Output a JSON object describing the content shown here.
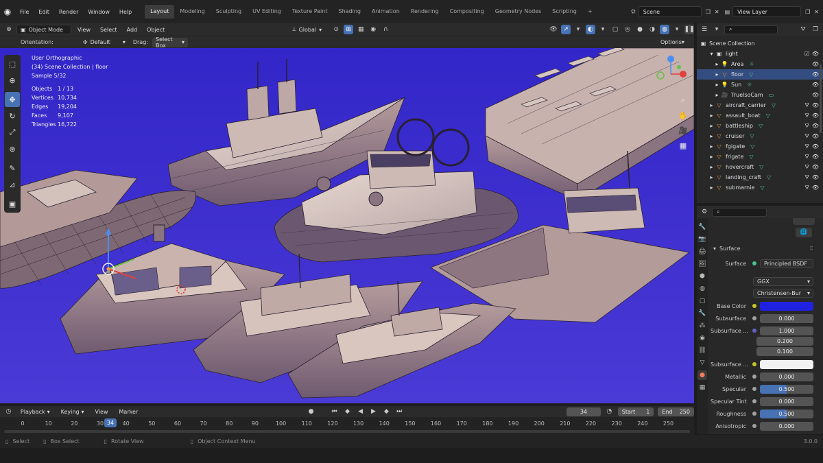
{
  "menubar": {
    "menus": [
      "File",
      "Edit",
      "Render",
      "Window",
      "Help"
    ],
    "workspaces": [
      "Layout",
      "Modeling",
      "Sculpting",
      "UV Editing",
      "Texture Paint",
      "Shading",
      "Animation",
      "Rendering",
      "Compositing",
      "Geometry Nodes",
      "Scripting"
    ],
    "active_workspace": "Layout",
    "add_tab": "+",
    "scene": "Scene",
    "view_layer": "View Layer"
  },
  "viewport_header": {
    "mode": "Object Mode",
    "menus": [
      "View",
      "Select",
      "Add",
      "Object"
    ],
    "transform_orientation": "Global"
  },
  "tool_settings": {
    "orientation_label": "Orientation:",
    "orientation_value": "Default",
    "drag_label": "Drag:",
    "drag_value": "Select Box",
    "options": "Options"
  },
  "viewport_overlay": {
    "view": "User Orthographic",
    "collection": "(34) Scene Collection | floor",
    "sample": "Sample 5/32",
    "stats": [
      {
        "label": "Objects",
        "value": "1 / 13"
      },
      {
        "label": "Vertices",
        "value": "10,734"
      },
      {
        "label": "Edges",
        "value": "19,204"
      },
      {
        "label": "Faces",
        "value": "9,107"
      },
      {
        "label": "Triangles",
        "value": "16,722"
      }
    ]
  },
  "timeline": {
    "menus": [
      "Playback",
      "Keying",
      "View",
      "Marker"
    ],
    "current_frame": "34",
    "start_label": "Start",
    "start": "1",
    "end_label": "End",
    "end": "250",
    "ticks": [
      "0",
      "10",
      "20",
      "30",
      "40",
      "50",
      "60",
      "70",
      "80",
      "90",
      "100",
      "110",
      "120",
      "130",
      "140",
      "150",
      "160",
      "170",
      "180",
      "190",
      "200",
      "210",
      "220",
      "230",
      "240",
      "250"
    ]
  },
  "statusbar": {
    "select": "Select",
    "box_select": "Box Select",
    "rotate_view": "Rotate View",
    "context_menu": "Object Context Menu",
    "version": "3.0.0"
  },
  "outliner": {
    "root": "Scene Collection",
    "rows": [
      {
        "name": "light",
        "indent": 1,
        "kind": "collection"
      },
      {
        "name": "Area",
        "indent": 2,
        "kind": "light"
      },
      {
        "name": "floor",
        "indent": 2,
        "kind": "mesh",
        "selected": true
      },
      {
        "name": "Sun",
        "indent": 2,
        "kind": "light"
      },
      {
        "name": "TrueIsoCam",
        "indent": 2,
        "kind": "camera"
      },
      {
        "name": "aircraft_carrier",
        "indent": 1,
        "kind": "mesh"
      },
      {
        "name": "assault_boat",
        "indent": 1,
        "kind": "mesh"
      },
      {
        "name": "battleship",
        "indent": 1,
        "kind": "mesh"
      },
      {
        "name": "cruiser",
        "indent": 1,
        "kind": "mesh"
      },
      {
        "name": "fgigate",
        "indent": 1,
        "kind": "mesh"
      },
      {
        "name": "frigate",
        "indent": 1,
        "kind": "mesh"
      },
      {
        "name": "hovercraft",
        "indent": 1,
        "kind": "mesh"
      },
      {
        "name": "landing_craft",
        "indent": 1,
        "kind": "mesh"
      },
      {
        "name": "submarnie",
        "indent": 1,
        "kind": "mesh"
      }
    ]
  },
  "properties": {
    "section": "Surface",
    "surface_label": "Surface",
    "surface_value": "Principled BSDF",
    "distribution": "GGX",
    "subsurface_method": "Christensen-Bur",
    "base_color_label": "Base Color",
    "base_color": "#1f22e0",
    "subsurface_label": "Subsurface",
    "subsurface": "0.000",
    "subsurface_radius_label": "Subsurface ...",
    "subsurface_radius": [
      "1.000",
      "0.200",
      "0.100"
    ],
    "subsurface_color_label": "Subsurface ...",
    "metallic_label": "Metallic",
    "metallic": "0.000",
    "specular_label": "Specular",
    "specular": "0.500",
    "specular_tint_label": "Specular Tint",
    "specular_tint": "0.000",
    "roughness_label": "Roughness",
    "roughness": "0.500",
    "anisotropic_label": "Anisotropic",
    "anisotropic": "0.000"
  }
}
